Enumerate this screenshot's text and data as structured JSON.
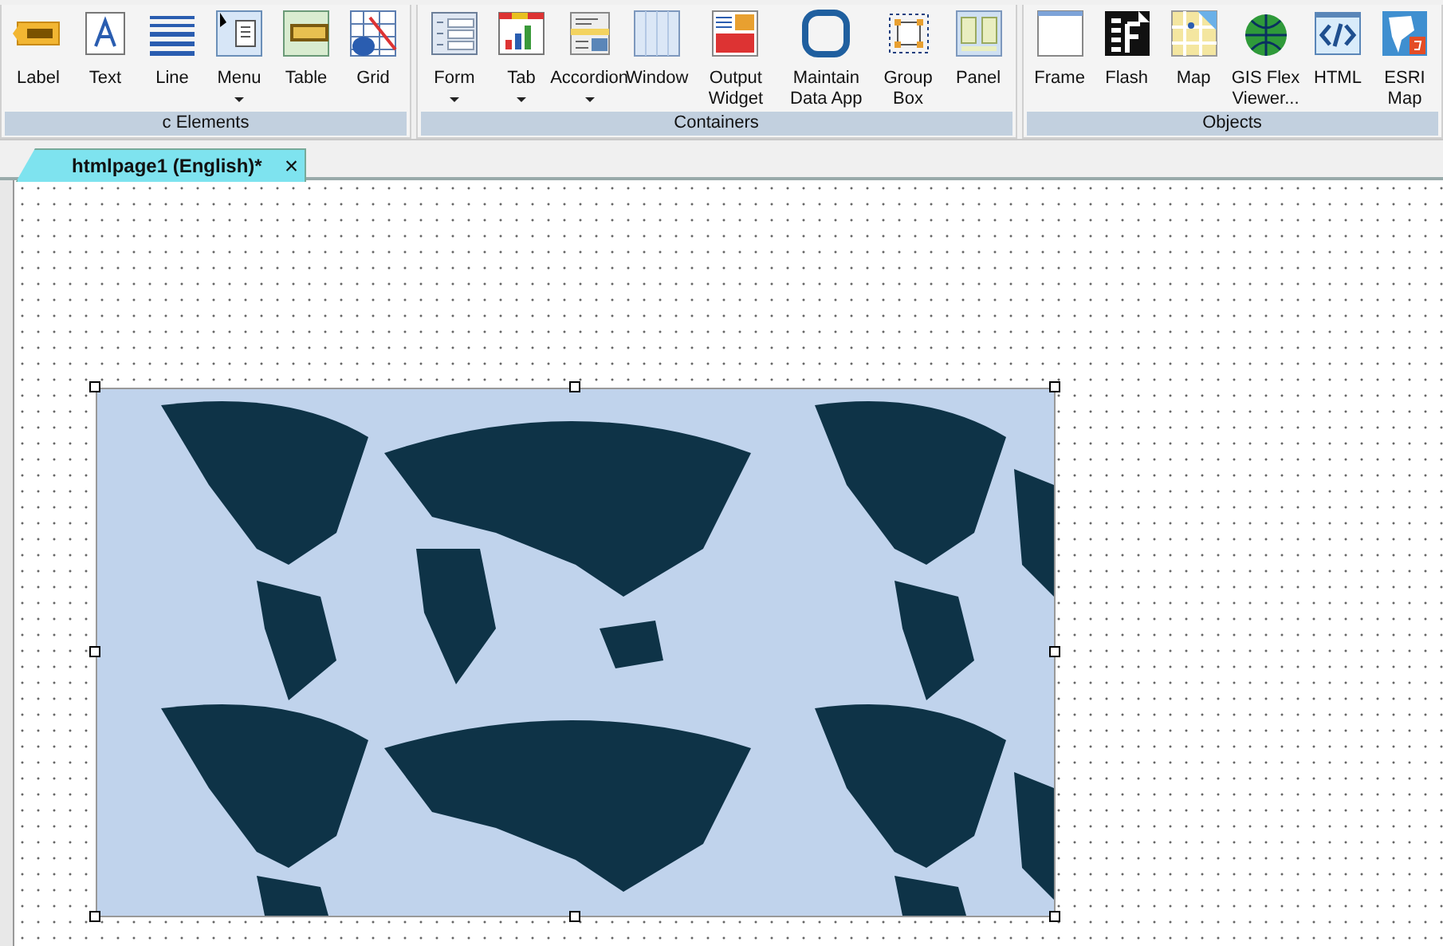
{
  "ribbon": {
    "groups": [
      {
        "label": "c Elements",
        "items": [
          {
            "label": "Label",
            "dropdown": false
          },
          {
            "label": "Text",
            "dropdown": false
          },
          {
            "label": "Line",
            "dropdown": false
          },
          {
            "label": "Menu",
            "dropdown": true
          },
          {
            "label": "Table",
            "dropdown": false
          },
          {
            "label": "Grid",
            "dropdown": false
          }
        ]
      },
      {
        "label": "Containers",
        "items": [
          {
            "label": "Form",
            "dropdown": true
          },
          {
            "label": "Tab",
            "dropdown": true
          },
          {
            "label": "Accordion",
            "dropdown": true
          },
          {
            "label": "Window",
            "dropdown": false
          },
          {
            "label": "Output Widget",
            "dropdown": false
          },
          {
            "label": "Maintain Data App",
            "dropdown": false
          },
          {
            "label": "Group Box",
            "dropdown": false
          },
          {
            "label": "Panel",
            "dropdown": false
          }
        ]
      },
      {
        "label": "Objects",
        "items": [
          {
            "label": "Frame",
            "dropdown": false
          },
          {
            "label": "Flash",
            "dropdown": false
          },
          {
            "label": "Map",
            "dropdown": false
          },
          {
            "label": "GIS Flex Viewer...",
            "dropdown": false
          },
          {
            "label": "HTML",
            "dropdown": false
          },
          {
            "label": "ESRI Map",
            "dropdown": false
          }
        ]
      }
    ]
  },
  "document_tabs": [
    {
      "label": "htmlpage1 (English)*",
      "selected": true,
      "close": "×"
    }
  ],
  "canvas": {
    "map_element": {
      "selected": true
    }
  }
}
